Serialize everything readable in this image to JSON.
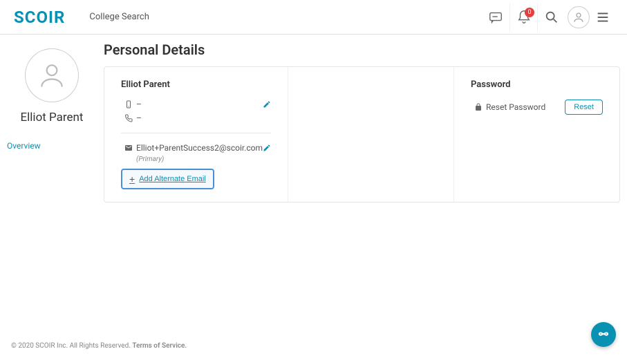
{
  "header": {
    "logo": "SCOIR",
    "nav": {
      "college_search": "College Search"
    },
    "notifications_count": "0"
  },
  "sidebar": {
    "profile_name": "Elliot Parent",
    "links": {
      "overview": "Overview"
    }
  },
  "main": {
    "title": "Personal Details",
    "contact": {
      "name": "Elliot Parent",
      "mobile": "–",
      "phone": "–",
      "email": "Elliot+ParentSuccess2@scoir.com",
      "email_tag": "(Primary)",
      "add_alternate": "Add Alternate Email"
    },
    "password": {
      "title": "Password",
      "label": "Reset Password",
      "button": "Reset"
    }
  },
  "footer": {
    "copyright": "© 2020 SCOIR Inc. All Rights Reserved.",
    "tos": "Terms of Service."
  }
}
